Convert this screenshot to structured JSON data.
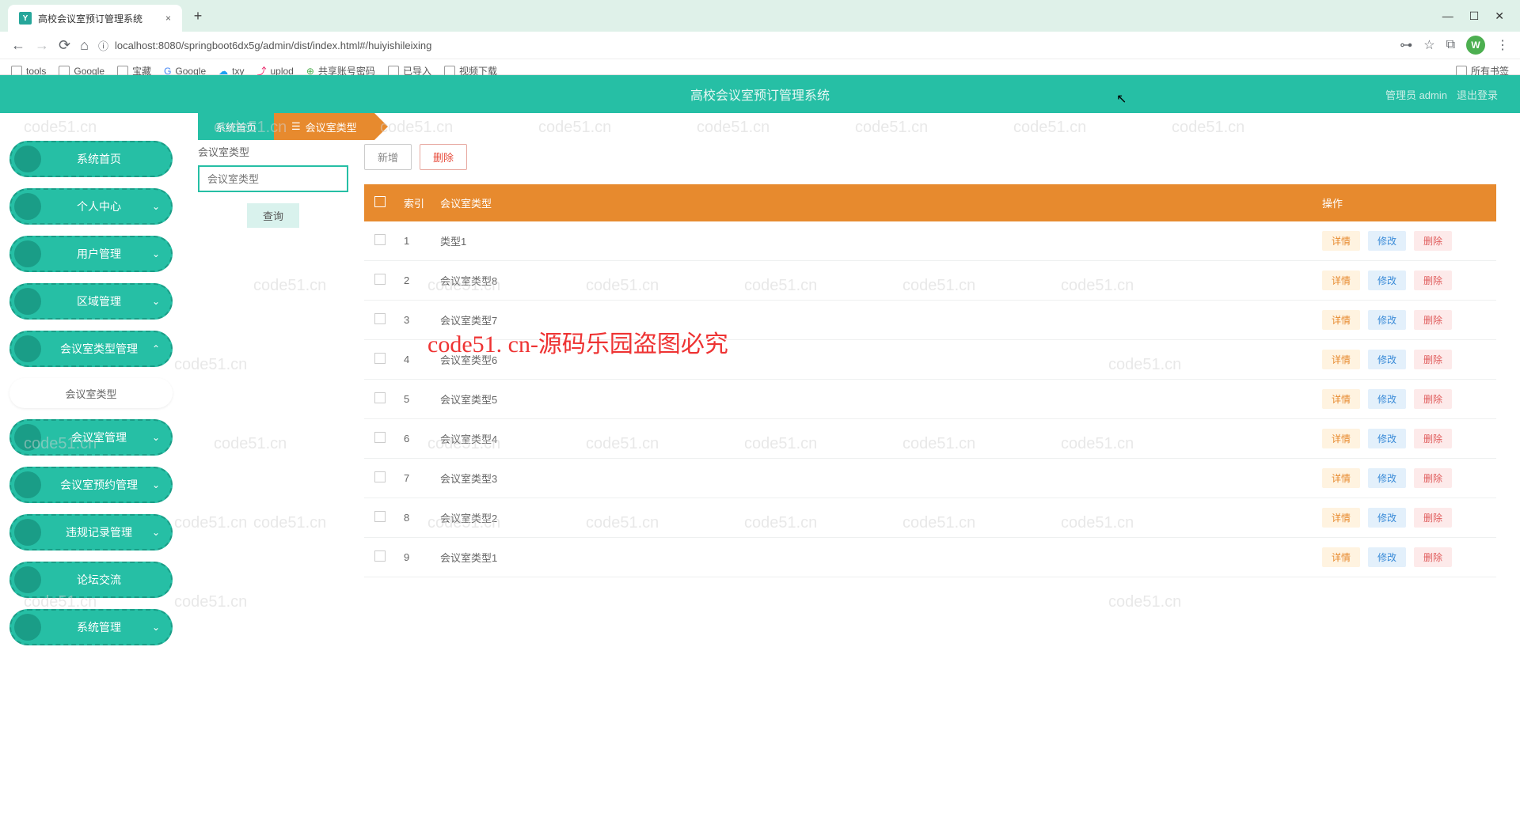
{
  "browser": {
    "tab_title": "高校会议室预订管理系统",
    "url": "localhost:8080/springboot6dx5g/admin/dist/index.html#/huiyishileixing",
    "bookmarks": [
      "tools",
      "Google",
      "宝藏",
      "Google",
      "txy",
      "uplod",
      "共享账号密码",
      "已导入",
      "视频下载"
    ],
    "all_bookmarks": "所有书签",
    "avatar_letter": "W"
  },
  "header": {
    "title": "高校会议室预订管理系统",
    "admin_label": "管理员 admin",
    "logout": "退出登录"
  },
  "breadcrumb": {
    "home": "系统首页",
    "current": "会议室类型"
  },
  "sidebar": {
    "items": [
      {
        "label": "系统首页",
        "expandable": false
      },
      {
        "label": "个人中心",
        "expandable": true
      },
      {
        "label": "用户管理",
        "expandable": true
      },
      {
        "label": "区域管理",
        "expandable": true
      },
      {
        "label": "会议室类型管理",
        "expandable": true,
        "open": true,
        "sub": "会议室类型"
      },
      {
        "label": "会议室管理",
        "expandable": true
      },
      {
        "label": "会议室预约管理",
        "expandable": true
      },
      {
        "label": "违规记录管理",
        "expandable": true
      },
      {
        "label": "论坛交流",
        "expandable": false
      },
      {
        "label": "系统管理",
        "expandable": true
      }
    ]
  },
  "search": {
    "label": "会议室类型",
    "placeholder": "会议室类型",
    "button": "查询"
  },
  "toolbar": {
    "add": "新增",
    "delete": "删除"
  },
  "table": {
    "headers": {
      "index": "索引",
      "type": "会议室类型",
      "action": "操作"
    },
    "actions": {
      "detail": "详情",
      "edit": "修改",
      "del": "删除"
    },
    "rows": [
      {
        "idx": "1",
        "name": "类型1"
      },
      {
        "idx": "2",
        "name": "会议室类型8"
      },
      {
        "idx": "3",
        "name": "会议室类型7"
      },
      {
        "idx": "4",
        "name": "会议室类型6"
      },
      {
        "idx": "5",
        "name": "会议室类型5"
      },
      {
        "idx": "6",
        "name": "会议室类型4"
      },
      {
        "idx": "7",
        "name": "会议室类型3"
      },
      {
        "idx": "8",
        "name": "会议室类型2"
      },
      {
        "idx": "9",
        "name": "会议室类型1"
      }
    ]
  },
  "watermark_text": "code51.cn",
  "big_watermark": "code51. cn-源码乐园盗图必究"
}
